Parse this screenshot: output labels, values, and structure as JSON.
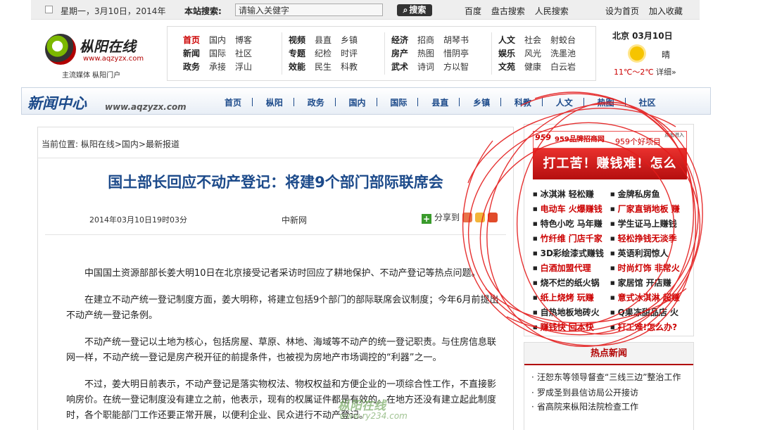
{
  "topbar": {
    "date": "星期一，3月10日，2014年",
    "search_label": "本站搜索:",
    "search_placeholder": "请输入关健字",
    "search_button": "搜索",
    "links": [
      "百度",
      "盘古搜索",
      "人民搜索"
    ],
    "right_links": [
      "设为首页",
      "加入收藏"
    ]
  },
  "logo": {
    "title": "枞阳在线",
    "url": "www.aqzyzx.com",
    "slogan": "主流媒体    枞阳门户"
  },
  "nav": {
    "groups": [
      {
        "rows": [
          [
            "首页",
            "国内",
            "博客"
          ],
          [
            "新闻",
            "国际",
            "社区"
          ],
          [
            "政务",
            "承接",
            "浮山"
          ]
        ]
      },
      {
        "rows": [
          [
            "视频",
            "县直",
            "乡镇"
          ],
          [
            "专题",
            "纪检",
            "时评"
          ],
          [
            "效能",
            "民生",
            "科教"
          ]
        ]
      },
      {
        "rows": [
          [
            "经济",
            "招商",
            "胡琴书"
          ],
          [
            "房产",
            "热图",
            "惜阴亭"
          ],
          [
            "武术",
            "诗词",
            "方以智"
          ]
        ]
      },
      {
        "rows": [
          [
            "人文",
            "社会",
            "射蛟台"
          ],
          [
            "娱乐",
            "风光",
            "洗墨池"
          ],
          [
            "文苑",
            "健康",
            "白云岩"
          ]
        ]
      }
    ]
  },
  "weather": {
    "city": "北京 03月10日",
    "condition": "晴",
    "temp": "11℃～2℃",
    "detail": "详细»"
  },
  "channel": {
    "title": "新闻中心",
    "url": "www.aqzyzx.com",
    "links": [
      "首页",
      "枞阳",
      "政务",
      "国内",
      "国际",
      "县直",
      "乡镇",
      "科教",
      "人文",
      "热图",
      "社区"
    ]
  },
  "article": {
    "crumb_label": "当前位置:",
    "crumb_path": "枞阳在线>国内>最新报道",
    "title": "国土部长回应不动产登记：将建9个部门部际联席会",
    "datetime": "2014年03月10日19时03分",
    "source": "中新网",
    "share_label": "分享到",
    "paragraphs": [
      "中国国土资源部部长姜大明10日在北京接受记者采访时回应了耕地保护、不动产登记等热点问题。",
      "在建立不动产统一登记制度方面，姜大明称，将建立包括9个部门的部际联席会议制度；今年6月前提出不动产统一登记条例。",
      "不动产统一登记以土地为核心，包括房屋、草原、林地、海域等不动产的统一登记职责。与住房信息联网一样，不动产统一登记是房产税开征的前提条件，也被视为房地产市场调控的“利器”之一。",
      "不过，姜大明日前表示，不动产登记是落实物权法、物权权益和方便企业的一项综合性工作，不直接影响房价。在统一登记制度没有建立之前，他表示，现有的权属证件都是有效的。在地方还没有建立起此制度时，各个职能部门工作还要正常开展，以便利企业、民众进行不动产登记。"
    ]
  },
  "ad": {
    "brand": "959",
    "brand_text": "959品牌招商网",
    "brand_url": "www.959.cn",
    "headline_small": "959个好项目",
    "enter": "点击进入",
    "banner": "打工苦！赚钱难！怎么办？",
    "items": [
      [
        "冰淇淋 轻松赚",
        "金牌私房鱼"
      ],
      [
        "电动车 火爆赚钱",
        "厂家直销地板 赚"
      ],
      [
        "特色小吃 马年赚",
        "学生证马上赚钱"
      ],
      [
        "竹纤维 门店千家",
        "轻松挣钱无淡季"
      ],
      [
        "3D彩绘漆式赚钱",
        "英语利润惊人"
      ],
      [
        "白酒加盟代理",
        "时尚灯饰 非常火"
      ],
      [
        "烧不烂的纸火锅",
        "家居馆 开店赚"
      ],
      [
        "纸上烧烤 玩赚",
        "意式冰淇淋 超赚"
      ],
      [
        "自热地板地砖火",
        "Q果冻甜品店 火"
      ],
      [
        "赚钱快 回本快",
        "打工难!怎么办?"
      ]
    ],
    "item_colors": [
      [
        "blk",
        "blk"
      ],
      [
        "red",
        "red"
      ],
      [
        "blk",
        "blk"
      ],
      [
        "red",
        "red"
      ],
      [
        "blk",
        "blk"
      ],
      [
        "red",
        "red"
      ],
      [
        "blk",
        "blk"
      ],
      [
        "red",
        "red"
      ],
      [
        "blk",
        "blk"
      ],
      [
        "red",
        "red"
      ]
    ]
  },
  "hot": {
    "title": "热点新闻",
    "items": [
      "汪恕东等领导督查“三线三边”整治工作",
      "罗成圣到县信访局公开接访",
      "省高院来枞阳法院检查工作"
    ]
  },
  "watermark": {
    "text": "枞阳在线",
    "url": "www.ry234.com"
  },
  "colors": {
    "accent_blue": "#1c4a8a",
    "accent_red": "#c00000",
    "scribble_red": "#e41b1b"
  }
}
